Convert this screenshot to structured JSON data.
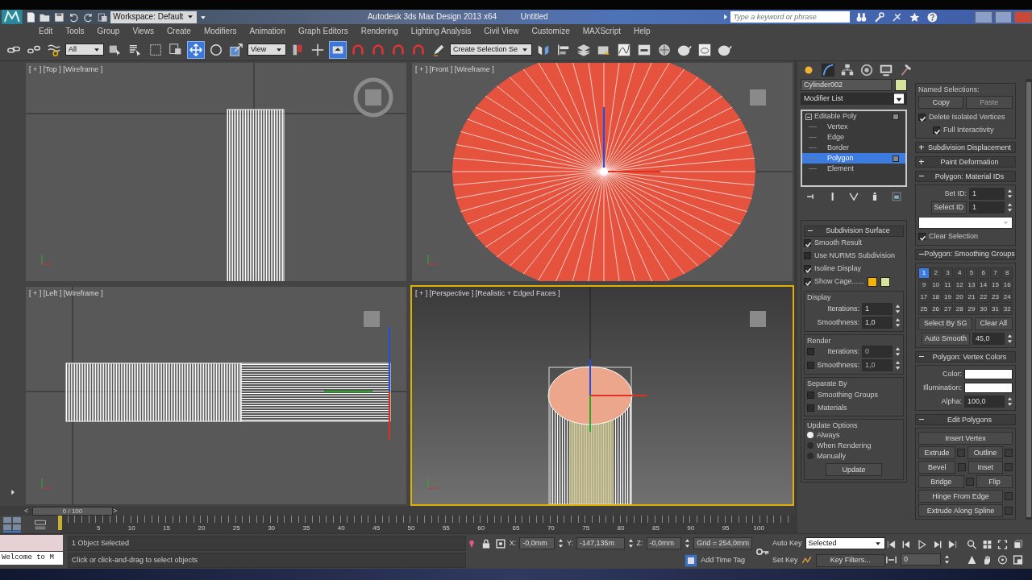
{
  "title_bar": {
    "workspace": "Workspace: Default",
    "app_title": "Autodesk 3ds Max Design 2013 x64",
    "document": "Untitled",
    "search": {
      "placeholder": "Type a keyword or phrase"
    }
  },
  "menu": [
    "Edit",
    "Tools",
    "Group",
    "Views",
    "Create",
    "Modifiers",
    "Animation",
    "Graph Editors",
    "Rendering",
    "Lighting Analysis",
    "Civil View",
    "Customize",
    "MAXScript",
    "Help"
  ],
  "toolbar": [
    {
      "kind": "link",
      "selected": false
    },
    {
      "kind": "unlink",
      "selected": false
    },
    {
      "kind": "bind",
      "selected": false
    },
    {
      "kind": "dropdown",
      "value": "All"
    },
    {
      "kind": "select",
      "selected": false
    },
    {
      "kind": "select_by_name",
      "selected": false
    },
    {
      "kind": "region",
      "selected": false
    },
    {
      "kind": "crossing",
      "selected": false
    },
    {
      "kind": "move",
      "selected": true
    },
    {
      "kind": "rotate",
      "selected": false
    },
    {
      "kind": "scale",
      "selected": false
    },
    {
      "kind": "dropdown",
      "value": "View"
    },
    {
      "kind": "pivot",
      "selected": false
    },
    {
      "kind": "manipulate",
      "selected": false
    },
    {
      "kind": "keyboard",
      "selected": true
    },
    {
      "kind": "snap",
      "selected": false
    },
    {
      "kind": "snap",
      "selected": false
    },
    {
      "kind": "snap",
      "selected": false
    },
    {
      "kind": "snap",
      "selected": false
    },
    {
      "kind": "edit_named",
      "selected": false
    },
    {
      "kind": "dropdown",
      "value": "Create Selection Se"
    },
    {
      "kind": "mirror",
      "selected": false
    },
    {
      "kind": "align",
      "selected": false
    },
    {
      "kind": "layer",
      "selected": false
    },
    {
      "kind": "explorer",
      "selected": false
    },
    {
      "kind": "curve_editor",
      "selected": false
    },
    {
      "kind": "schematic",
      "selected": false
    },
    {
      "kind": "material",
      "selected": false
    },
    {
      "kind": "render_setup",
      "selected": false
    },
    {
      "kind": "frame_window",
      "selected": false
    },
    {
      "kind": "render",
      "selected": false
    }
  ],
  "viewports": [
    {
      "kind": "top",
      "label": "[ + ] [Top ] [Wireframe ]",
      "active": false
    },
    {
      "kind": "front",
      "label": "[ + ] [Front ] [Wireframe ]",
      "active": false
    },
    {
      "kind": "left",
      "label": "[ + ] [Left ] [Wireframe ]",
      "active": false
    },
    {
      "kind": "perspective",
      "label": "[ + ] [Perspective ] [Realistic + Edged Faces ]",
      "active": true
    }
  ],
  "command_panel": {
    "object": {
      "name": "Cylinder002",
      "color": "#d4e49a"
    },
    "modifier_list": "Modifier List",
    "stack": [
      {
        "label": "Editable Poly",
        "expanded": true,
        "selected": false,
        "children": [
          {
            "label": "Vertex",
            "selected": false
          },
          {
            "label": "Edge",
            "selected": false
          },
          {
            "label": "Border",
            "selected": false
          },
          {
            "label": "Polygon",
            "selected": true
          },
          {
            "label": "Element",
            "selected": false
          }
        ]
      }
    ],
    "subdivision_surface": {
      "title": "Subdivision Surface",
      "expanded": true,
      "options": [
        {
          "label": "Smooth Result",
          "checked": true
        },
        {
          "label": "Use NURMS Subdivision",
          "checked": false
        },
        {
          "label": "Isoline Display",
          "checked": true
        },
        {
          "label": "Show Cage......",
          "checked": true
        }
      ],
      "cage_colors": [
        {
          "color": "#f5b400"
        },
        {
          "color": "#d8e49a"
        }
      ],
      "display": {
        "title": "Display",
        "rows": [
          {
            "label": "Iterations:",
            "value": "1"
          },
          {
            "label": "Smoothness:",
            "value": "1,0"
          }
        ]
      },
      "render": {
        "title": "Render",
        "rows": [
          {
            "label": "Iterations:",
            "value": "0",
            "checked": false
          },
          {
            "label": "Smoothness:",
            "value": "1,0",
            "checked": false
          }
        ]
      },
      "separate_by": {
        "title": "Separate By",
        "options": [
          {
            "label": "Smoothing Groups",
            "checked": false
          },
          {
            "label": "Materials",
            "checked": false
          }
        ]
      },
      "update_options": {
        "title": "Update Options",
        "options": [
          {
            "label": "Always",
            "selected": true
          },
          {
            "label": "When Rendering",
            "selected": false
          },
          {
            "label": "Manually",
            "selected": false
          }
        ],
        "button": "Update"
      }
    },
    "selection": {
      "title": "Named Selections:",
      "buttons": [
        {
          "label": "Copy",
          "disabled": false
        },
        {
          "label": "Paste",
          "disabled": true
        }
      ],
      "options": [
        {
          "label": "Delete Isolated Vertices",
          "checked": true
        },
        {
          "label": "Full Interactivity",
          "checked": true
        }
      ]
    },
    "rollouts": [
      {
        "title": "Subdivision Displacement",
        "expanded": false
      },
      {
        "title": "Paint Deformation",
        "expanded": false
      }
    ],
    "material_ids": {
      "title": "Polygon: Material IDs",
      "expanded": true,
      "set_id_label": "Set ID:",
      "set_id": "1",
      "select_id_button": "Select ID",
      "select_id": "1",
      "clear_selection": {
        "label": "Clear Selection",
        "checked": true
      }
    },
    "smoothing_groups": {
      "title": "Polygon: Smoothing Groups",
      "expanded": true,
      "groups": [
        {
          "label": "1",
          "selected": true
        },
        {
          "label": "2",
          "selected": false
        },
        {
          "label": "3",
          "selected": false
        },
        {
          "label": "4",
          "selected": false
        },
        {
          "label": "5",
          "selected": false
        },
        {
          "label": "6",
          "selected": false
        },
        {
          "label": "7",
          "selected": false
        },
        {
          "label": "8",
          "selected": false
        },
        {
          "label": "9",
          "selected": false
        },
        {
          "label": "10",
          "selected": false
        },
        {
          "label": "11",
          "selected": false
        },
        {
          "label": "12",
          "selected": false
        },
        {
          "label": "13",
          "selected": false
        },
        {
          "label": "14",
          "selected": false
        },
        {
          "label": "15",
          "selected": false
        },
        {
          "label": "16",
          "selected": false
        },
        {
          "label": "17",
          "selected": false
        },
        {
          "label": "18",
          "selected": false
        },
        {
          "label": "19",
          "selected": false
        },
        {
          "label": "20",
          "selected": false
        },
        {
          "label": "21",
          "selected": false
        },
        {
          "label": "22",
          "selected": false
        },
        {
          "label": "23",
          "selected": false
        },
        {
          "label": "24",
          "selected": false
        },
        {
          "label": "25",
          "selected": false
        },
        {
          "label": "26",
          "selected": false
        },
        {
          "label": "27",
          "selected": false
        },
        {
          "label": "28",
          "selected": false
        },
        {
          "label": "29",
          "selected": false
        },
        {
          "label": "30",
          "selected": false
        },
        {
          "label": "31",
          "selected": false
        },
        {
          "label": "32",
          "selected": false
        }
      ],
      "buttons": [
        "Select By SG",
        "Clear All"
      ],
      "auto_smooth_button": "Auto Smooth",
      "auto_smooth": "45,0"
    },
    "vertex_colors": {
      "title": "Polygon: Vertex Colors",
      "expanded": true,
      "swatches": [
        {
          "label": "Color:",
          "color": "#ffffff"
        },
        {
          "label": "Illumination:",
          "color": "#ffffff"
        }
      ],
      "alpha_label": "Alpha:",
      "alpha": "100,0"
    },
    "edit_polygons": {
      "title": "Edit Polygons",
      "expanded": true,
      "buttons": [
        {
          "label": "Insert Vertex",
          "kind": "wide",
          "settings": false
        },
        {
          "label": "Extrude",
          "kind": "half",
          "settings": true
        },
        {
          "label": "Outline",
          "kind": "half",
          "settings": true
        },
        {
          "label": "Bevel",
          "kind": "half",
          "settings": true
        },
        {
          "label": "Inset",
          "kind": "half",
          "settings": true
        },
        {
          "label": "Bridge",
          "kind": "half",
          "settings": true
        },
        {
          "label": "Flip",
          "kind": "half",
          "settings": false
        },
        {
          "label": "Hinge From Edge",
          "kind": "wide",
          "settings": true
        },
        {
          "label": "Extrude Along Spline",
          "kind": "wide",
          "settings": true
        }
      ]
    }
  },
  "time_slider": {
    "prev": "<",
    "label": "0 / 100",
    "level": 0,
    "next": ">"
  },
  "ruler_labels": [
    "5",
    "10",
    "15",
    "20",
    "25",
    "30",
    "35",
    "40",
    "45",
    "50",
    "55",
    "60",
    "65",
    "70",
    "75",
    "80",
    "85",
    "90",
    "95",
    "100"
  ],
  "status": {
    "maxscript": "Welcome to M",
    "selection": "1 Object Selected",
    "prompt": "Click or click-and-drag to select objects",
    "x_label": "X:",
    "x": "-0,0mm",
    "y_label": "Y:",
    "y": "-147,135m",
    "z_label": "Z:",
    "z": "-0,0mm",
    "grid": "Grid = 254,0mm",
    "add_time_tag": "Add Time Tag"
  },
  "animation": {
    "auto_key": "Auto Key",
    "key_mode": "Selected",
    "set_key": "Set Key",
    "key_filters": "Key Filters...",
    "frame": "0"
  }
}
